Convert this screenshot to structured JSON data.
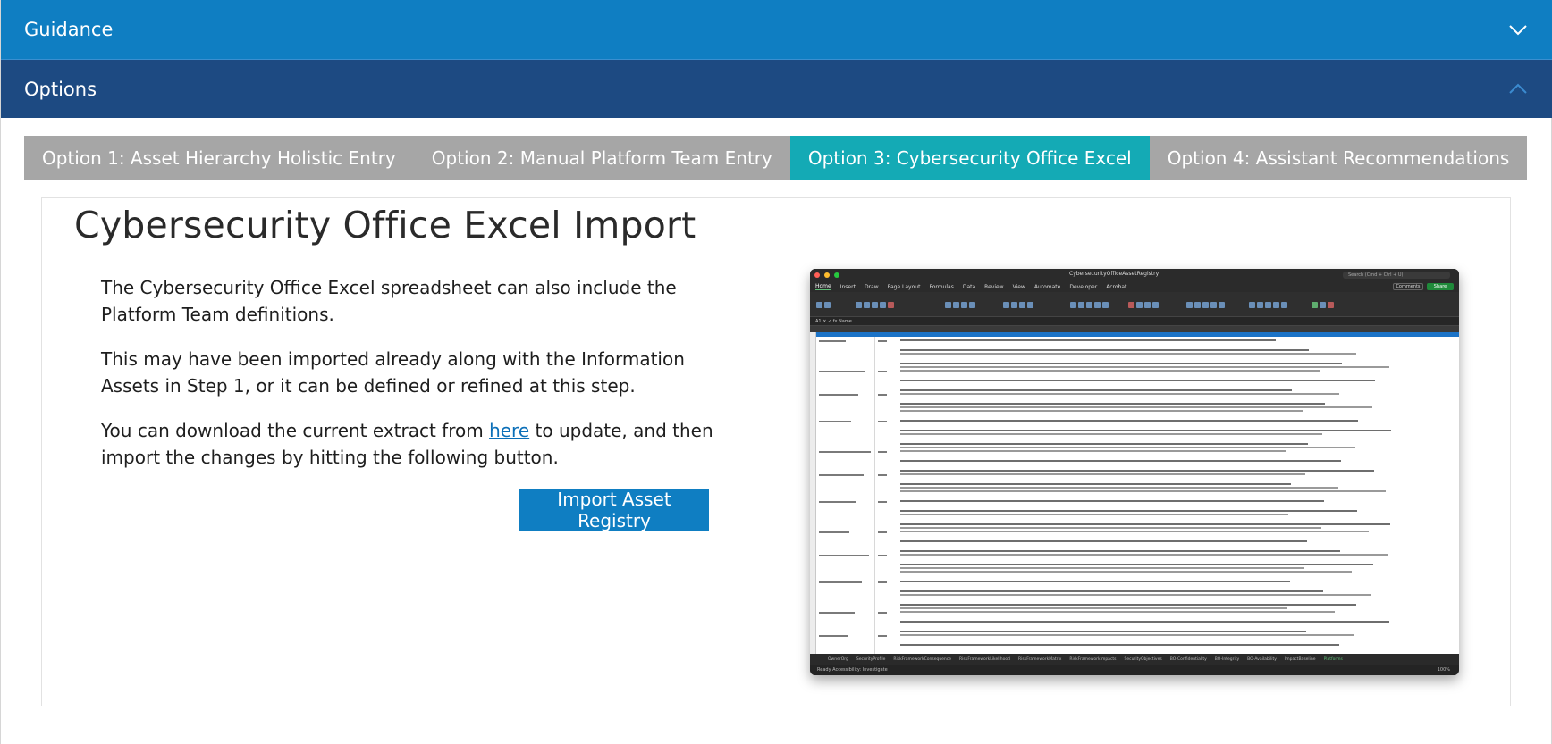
{
  "accordion": {
    "guidance_label": "Guidance",
    "options_label": "Options"
  },
  "tabs": [
    {
      "label": "Option 1: Asset Hierarchy Holistic Entry",
      "active": false
    },
    {
      "label": "Option 2: Manual Platform Team Entry",
      "active": false
    },
    {
      "label": "Option 3: Cybersecurity Office Excel",
      "active": true
    },
    {
      "label": "Option 4: Assistant Recommendations",
      "active": false
    }
  ],
  "panel": {
    "title": "Cybersecurity Office Excel Import",
    "paragraph1": "The Cybersecurity Office Excel spreadsheet can also include the Platform Team definitions.",
    "paragraph2": "This may have been imported already along with the Information Assets in Step 1, or it can be defined or refined at this step.",
    "paragraph3_before": "You can download the current extract from ",
    "paragraph3_link": "here",
    "paragraph3_after": " to update, and then import the changes by hitting the following button.",
    "import_button": "Import Asset Registry"
  },
  "screenshot": {
    "filename": "CybersecurityOfficeAssetRegistry",
    "search_placeholder": "Search (Cmd + Ctrl + U)",
    "menu": [
      "Home",
      "Insert",
      "Draw",
      "Page Layout",
      "Formulas",
      "Data",
      "Review",
      "View",
      "Automate",
      "Developer",
      "Acrobat"
    ],
    "comments_label": "Comments",
    "share_label": "Share",
    "formula_bar": "A1  ×  ✓  fx  Name",
    "sheet_tabs": [
      "OwnerOrg",
      "SecurityProfile",
      "RiskFrameworkConsequence",
      "RiskFrameworkLikelihood",
      "RiskFrameworkMatrix",
      "RiskFrameworkImpacts",
      "SecurityObjectives",
      "BO-Confidentiality",
      "BO-Integrity",
      "BO-Availability",
      "ImpactBaseline",
      "Platforms"
    ],
    "status": "Ready    Accessibility: Investigate",
    "zoom": "100%"
  },
  "colors": {
    "guidance_bar": "#0f7ec2",
    "options_bar": "#1d4a82",
    "tab_inactive": "#a6a6a6",
    "tab_active": "#14aab5",
    "button": "#0f7ec2"
  },
  "icons": {
    "guidance_toggle": "chevron-down-icon",
    "options_toggle": "chevron-up-icon"
  }
}
